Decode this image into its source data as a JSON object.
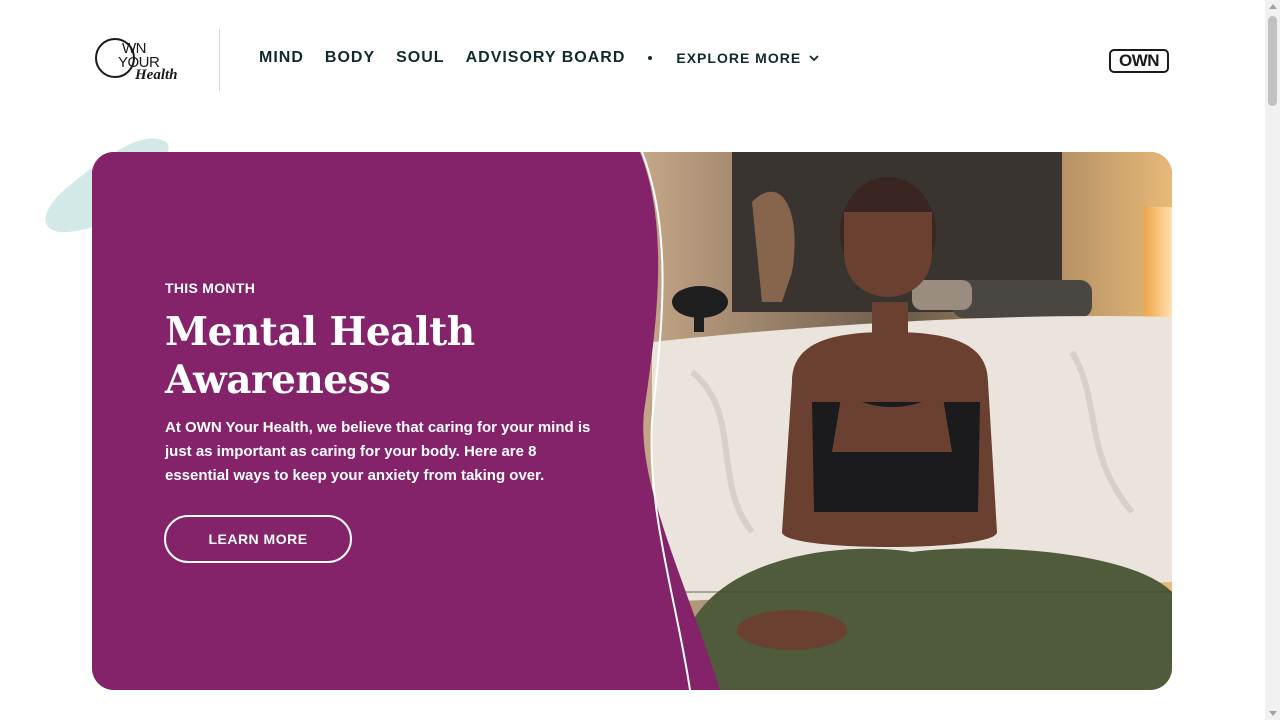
{
  "header": {
    "logo": {
      "line1": "WN",
      "line2": "YOUR",
      "line3": "Health"
    },
    "nav": [
      {
        "label": "MIND"
      },
      {
        "label": "BODY"
      },
      {
        "label": "SOUL"
      },
      {
        "label": "ADVISORY BOARD"
      }
    ],
    "explore_label": "EXPLORE MORE",
    "network_badge": "OWN"
  },
  "hero": {
    "eyebrow": "THIS MONTH",
    "title": "Mental Health Awareness",
    "description": "At OWN Your Health, we believe that caring for your mind is just as important as caring for your body. Here are 8 essential ways to keep your anxiety from taking over.",
    "button_label": "LEARN MORE"
  },
  "colors": {
    "brand_purple": "#84226a",
    "nav_text": "#0f2b2e",
    "accent_blob": "#d3e9e7"
  }
}
